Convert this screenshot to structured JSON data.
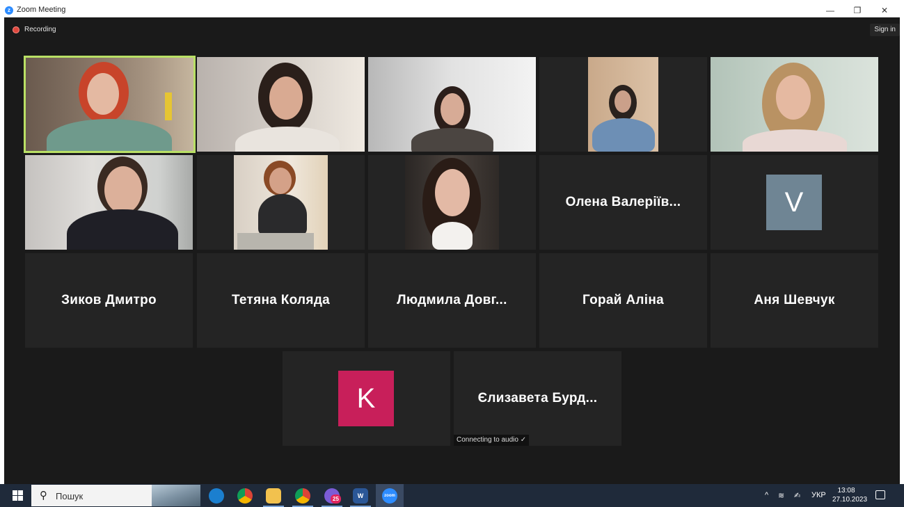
{
  "window": {
    "title": "Zoom Meeting",
    "controls": [
      "—",
      "❐",
      "✕"
    ]
  },
  "meeting": {
    "recording_label": "Recording",
    "sign_in_label": "Sign in",
    "name_tiles": [
      {
        "name": "Олена  Валеріїв..."
      },
      {
        "name": "Зиков Дмитро"
      },
      {
        "name": "Тетяна Коляда"
      },
      {
        "name": "Людмила  Довг..."
      },
      {
        "name": "Горай Аліна"
      },
      {
        "name": "Аня Шевчук"
      },
      {
        "name": "Єлизавета  Бурд..."
      }
    ],
    "avatar_tiles": [
      {
        "letter": "V",
        "color": "#6f8594"
      },
      {
        "letter": "K",
        "color": "#c81f5a"
      }
    ],
    "audio_status": "Connecting to audio ✓",
    "active_speaker_border": "#b9e065"
  },
  "taskbar": {
    "search_placeholder": "Пошук",
    "chat_badge": "25",
    "word_label": "W",
    "zoom_label": "zoom",
    "language": "УКР",
    "time": "13:08",
    "date": "27.10.2023"
  }
}
